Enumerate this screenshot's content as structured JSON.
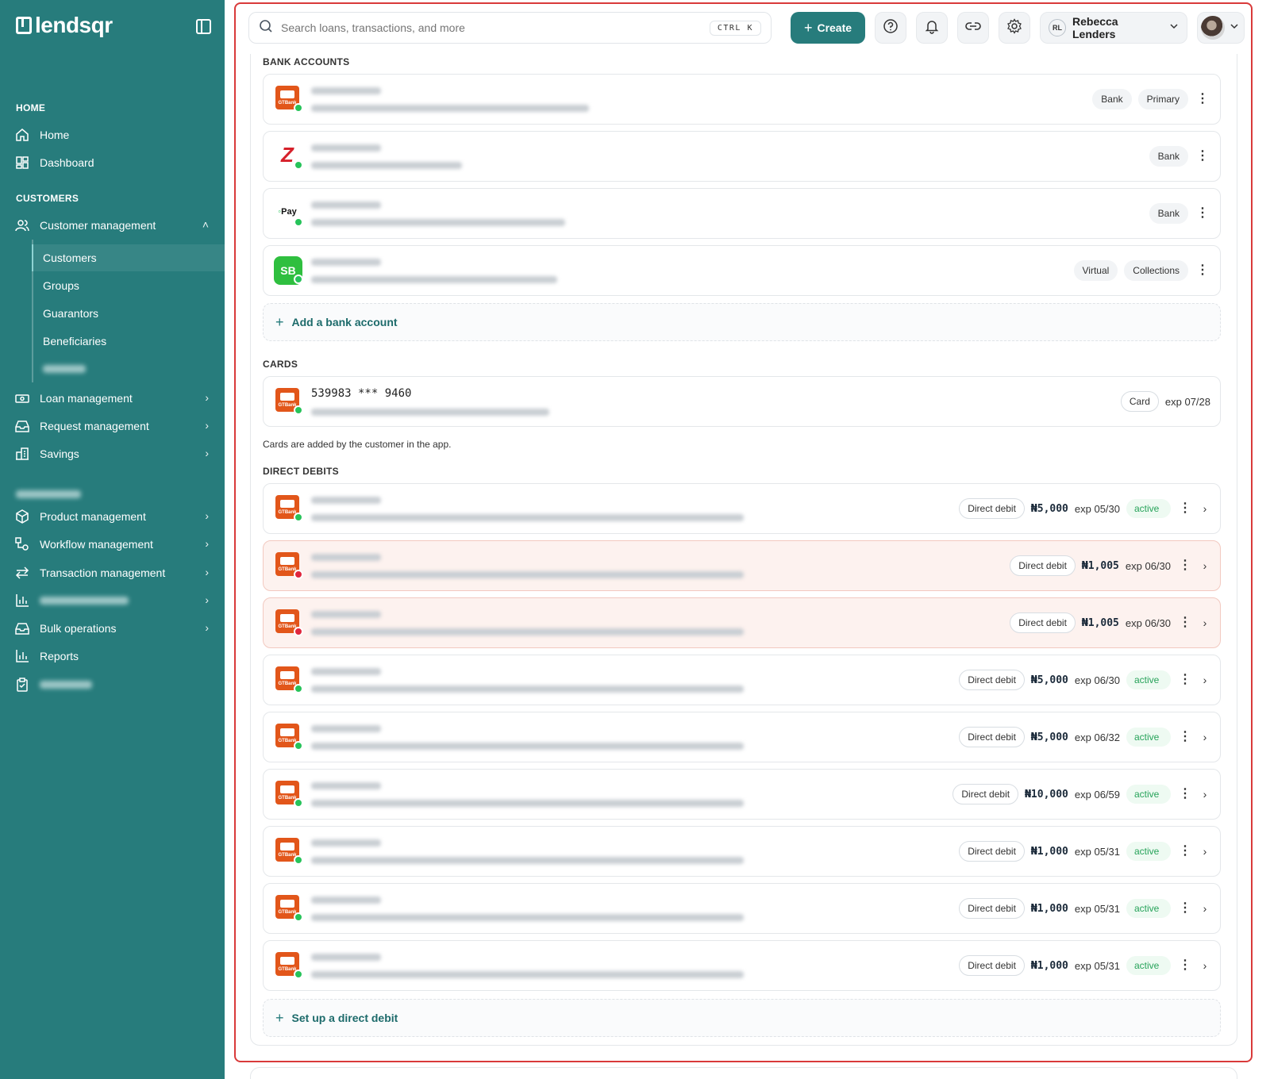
{
  "brand": {
    "name": "lendsqr"
  },
  "sidebar": {
    "sections": {
      "home": "HOME",
      "customers": "CUSTOMERS"
    },
    "items": {
      "home": "Home",
      "dashboard": "Dashboard",
      "customer_management": "Customer management",
      "customers": "Customers",
      "groups": "Groups",
      "guarantors": "Guarantors",
      "beneficiaries": "Beneficiaries",
      "loan_management": "Loan management",
      "request_management": "Request management",
      "savings": "Savings",
      "product_management": "Product management",
      "workflow_management": "Workflow management",
      "transaction_management": "Transaction management",
      "bulk_operations": "Bulk operations",
      "reports": "Reports"
    }
  },
  "topbar": {
    "search_placeholder": "Search loans, transactions, and more",
    "shortcut": "CTRL K",
    "create_label": "Create",
    "user_initials": "RL",
    "user_name": "Rebecca Lenders"
  },
  "bank_accounts": {
    "title": "BANK ACCOUNTS",
    "rows": [
      {
        "logo": "gtbank",
        "tags": [
          "Bank",
          "Primary"
        ]
      },
      {
        "logo": "zenith",
        "tags": [
          "Bank"
        ]
      },
      {
        "logo": "opay",
        "tags": [
          "Bank"
        ]
      },
      {
        "logo": "sb",
        "logo_text": "SB",
        "tags": [
          "Virtual",
          "Collections"
        ]
      }
    ],
    "add_label": "Add a bank account"
  },
  "cards": {
    "title": "CARDS",
    "card_number": "539983 *** 9460",
    "tag": "Card",
    "expiry": "exp 07/28",
    "note": "Cards are added by the customer in the app."
  },
  "direct_debits": {
    "title": "DIRECT DEBITS",
    "tag": "Direct debit",
    "rows": [
      {
        "amount": "₦5,000",
        "expiry": "exp 05/30",
        "status": "active",
        "state": "ok"
      },
      {
        "amount": "₦1,005",
        "expiry": "exp 06/30",
        "status": "",
        "state": "failed"
      },
      {
        "amount": "₦1,005",
        "expiry": "exp 06/30",
        "status": "",
        "state": "failed"
      },
      {
        "amount": "₦5,000",
        "expiry": "exp 06/30",
        "status": "active",
        "state": "ok"
      },
      {
        "amount": "₦5,000",
        "expiry": "exp 06/32",
        "status": "active",
        "state": "ok"
      },
      {
        "amount": "₦10,000",
        "expiry": "exp 06/59",
        "status": "active",
        "state": "ok"
      },
      {
        "amount": "₦1,000",
        "expiry": "exp 05/31",
        "status": "active",
        "state": "ok"
      },
      {
        "amount": "₦1,000",
        "expiry": "exp 05/31",
        "status": "active",
        "state": "ok"
      },
      {
        "amount": "₦1,000",
        "expiry": "exp 05/31",
        "status": "active",
        "state": "ok"
      }
    ],
    "add_label": "Set up a direct debit"
  },
  "colors": {
    "brand": "#277c7c",
    "active": "#27c35a",
    "failed": "#e0263d",
    "highlight": "#d93a3a"
  }
}
